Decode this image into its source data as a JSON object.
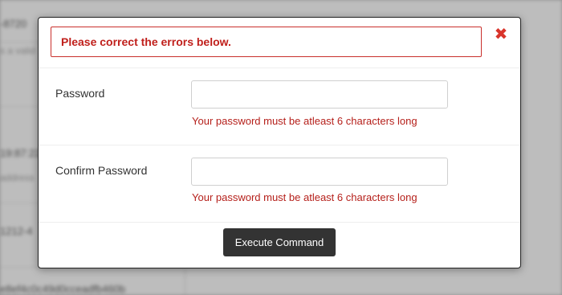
{
  "background": {
    "lines": [
      "-8720",
      "s a valid",
      "19:87:22",
      "address",
      "1212-4",
      "e8ef4c0c49d0cceadfb460b"
    ]
  },
  "dialog": {
    "alert": {
      "text": "Please correct the errors below.",
      "color": "#c0201c"
    },
    "close_glyph": "✖",
    "fields": [
      {
        "label": "Password",
        "value": "",
        "error": "Your password must be atleast 6 characters long"
      },
      {
        "label": "Confirm Password",
        "value": "",
        "error": "Your password must be atleast 6 characters long"
      }
    ],
    "submit_label": "Execute Command"
  }
}
